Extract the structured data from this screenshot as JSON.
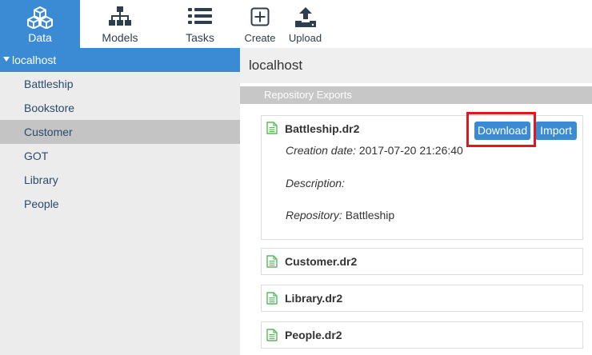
{
  "nav": {
    "tabs": [
      {
        "label": "Data",
        "icon": "cubes-icon",
        "active": true
      },
      {
        "label": "Models",
        "icon": "sitemap-icon"
      },
      {
        "label": "Tasks",
        "icon": "list-icon"
      }
    ],
    "actions": [
      {
        "label": "Create",
        "icon": "plus-square-icon"
      },
      {
        "label": "Upload",
        "icon": "upload-icon"
      }
    ]
  },
  "sidebar": {
    "root": "localhost",
    "items": [
      "Battleship",
      "Bookstore",
      "Customer",
      "GOT",
      "Library",
      "People"
    ],
    "selected": "Customer"
  },
  "main": {
    "title": "localhost",
    "section": "Repository Exports",
    "exports": [
      {
        "name": "Battleship.dr2",
        "expanded": true,
        "creation_label": "Creation date:",
        "creation_value": "2017-07-20 21:26:40",
        "description_label": "Description:",
        "repository_label": "Repository:",
        "repository_value": "Battleship",
        "download_label": "Download",
        "import_label": "Import"
      },
      {
        "name": "Customer.dr2"
      },
      {
        "name": "Library.dr2"
      },
      {
        "name": "People.dr2"
      }
    ]
  },
  "colors": {
    "accent": "#3a8bd4",
    "highlight": "#e8141d",
    "file_icon": "#5cb85c"
  }
}
